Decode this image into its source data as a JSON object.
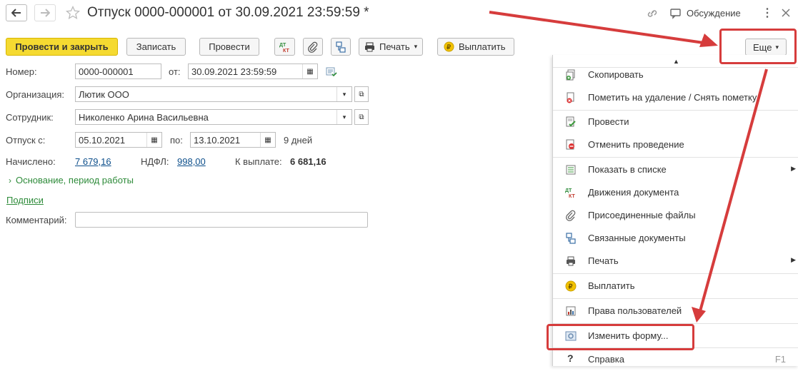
{
  "window": {
    "title": "Отпуск 0000-000001 от 30.09.2021 23:59:59 *",
    "discussion_label": "Обсуждение"
  },
  "toolbar": {
    "post_close": "Провести и закрыть",
    "save": "Записать",
    "post": "Провести",
    "print": "Печать",
    "pay": "Выплатить",
    "more": "Еще"
  },
  "form": {
    "number_label": "Номер:",
    "number_value": "0000-000001",
    "from_label": "от:",
    "date_value": "30.09.2021 23:59:59",
    "org_label": "Организация:",
    "org_value": "Лютик ООО",
    "employee_label": "Сотрудник:",
    "employee_value": "Николенко Арина Васильевна",
    "vacation_label": "Отпуск с:",
    "vacation_from": "05.10.2021",
    "to_label": "по:",
    "vacation_to": "13.10.2021",
    "days": "9 дней",
    "accrued_label": "Начислено:",
    "accrued_value": "7 679,16",
    "ndfl_label": "НДФЛ:",
    "ndfl_value": "998,00",
    "payout_label": "К выплате:",
    "payout_value": "6 681,16",
    "basis_toggle": "Основание, период работы",
    "signatures_link": "Подписи",
    "comment_label": "Комментарий:",
    "comment_value": ""
  },
  "menu": {
    "items": [
      {
        "label": "Скопировать",
        "icon": "copy-icon"
      },
      {
        "label": "Пометить на удаление / Снять пометку",
        "icon": "delete-mark-icon"
      },
      {
        "label": "Провести",
        "icon": "post-icon"
      },
      {
        "label": "Отменить проведение",
        "icon": "unpost-icon"
      },
      {
        "label": "Показать в списке",
        "icon": "show-in-list-icon"
      },
      {
        "label": "Движения документа",
        "icon": "dt-kt-icon"
      },
      {
        "label": "Присоединенные файлы",
        "icon": "paperclip-icon"
      },
      {
        "label": "Связанные документы",
        "icon": "related-docs-icon"
      },
      {
        "label": "Печать",
        "icon": "printer-icon"
      },
      {
        "label": "Выплатить",
        "icon": "ruble-coin-icon"
      },
      {
        "label": "Права пользователей",
        "icon": "user-rights-icon"
      },
      {
        "label": "Изменить форму...",
        "icon": "change-form-icon"
      },
      {
        "label": "Справка",
        "icon": "help-icon"
      }
    ],
    "help_shortcut": "F1"
  },
  "colors": {
    "primary_button": "#f5da31",
    "annotation_red": "#d63c3c",
    "link": "#0d4f8b",
    "green_text": "#2e8b3a"
  }
}
